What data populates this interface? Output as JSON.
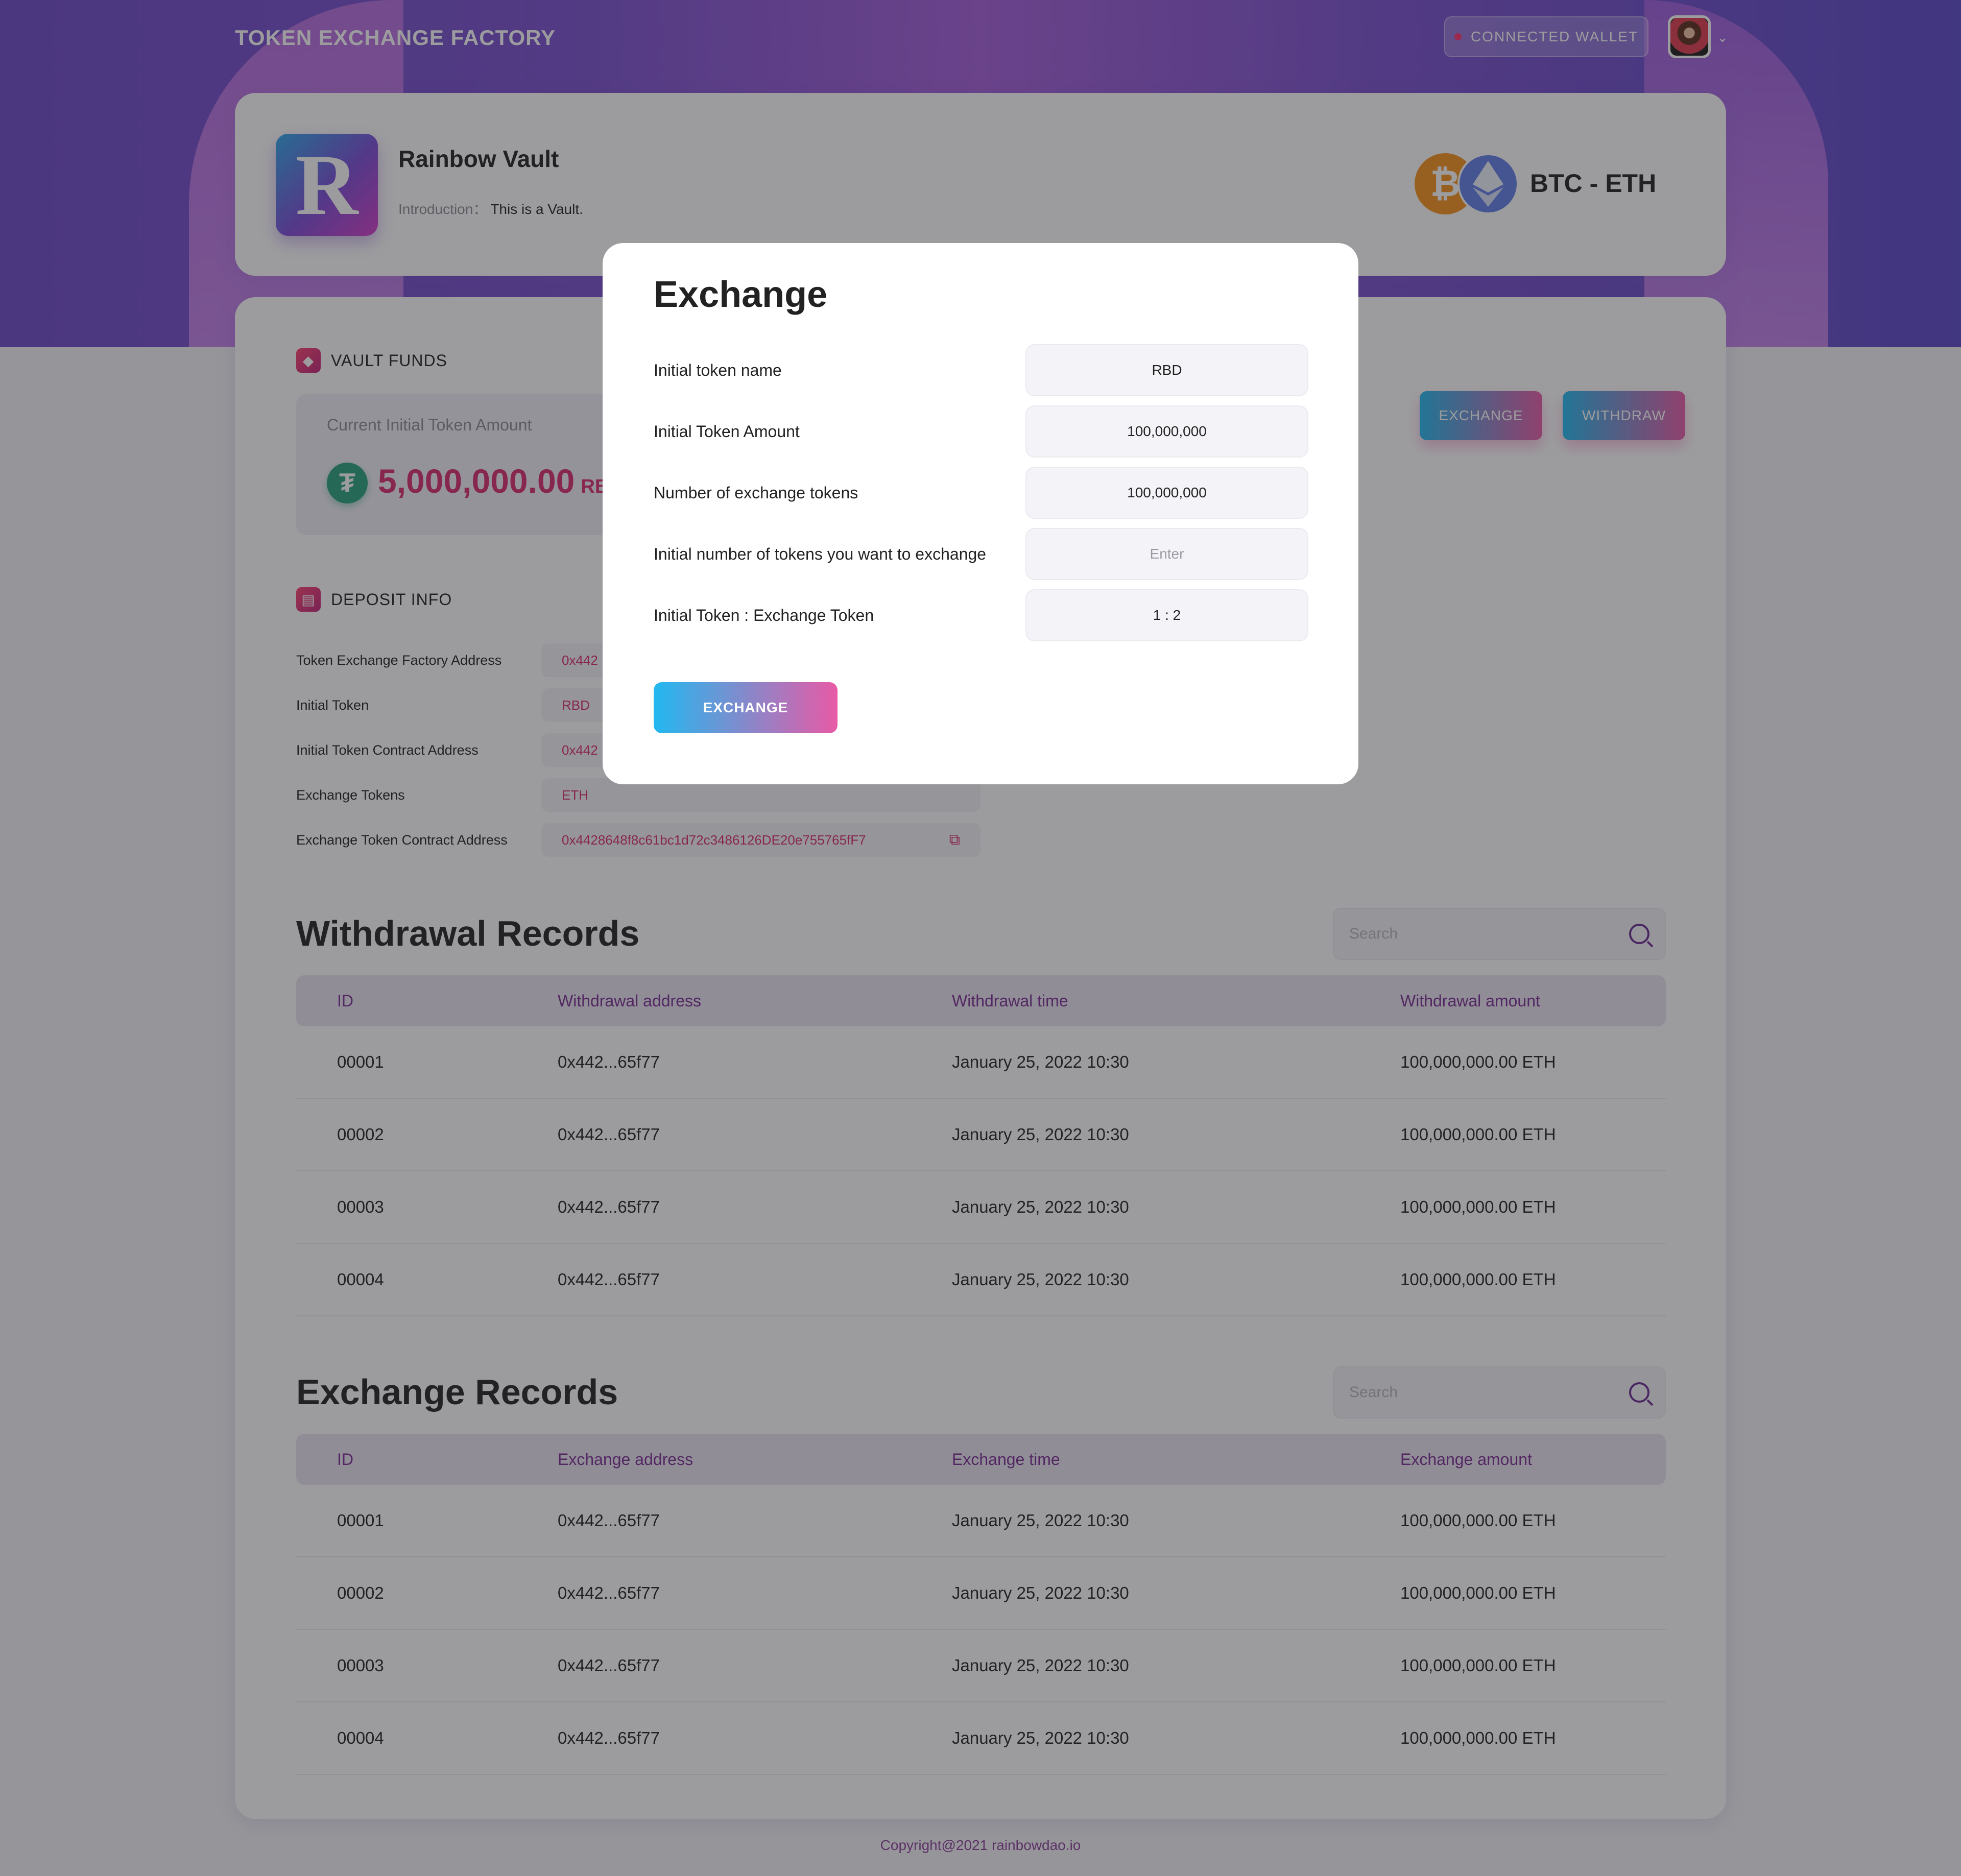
{
  "header": {
    "brand": "TOKEN EXCHANGE FACTORY",
    "wallet_label": "CONNECTED  WALLET",
    "chevron": "⌄"
  },
  "vault": {
    "logo_letter": "R",
    "name": "Rainbow Vault",
    "intro_label": "Introduction：",
    "intro_value": "This is a Vault.",
    "pair": "BTC - ETH",
    "btc_symbol": "₿",
    "eth_symbol": "◆"
  },
  "funds": {
    "section_title": "VAULT FUNDS",
    "label": "Current Initial Token Amount",
    "value": "5,000,000.00",
    "unit": "RBD",
    "tether_symbol": "₮",
    "exchange_btn": "EXCHANGE",
    "withdraw_btn": "WITHDRAW"
  },
  "deposit": {
    "section_title": "DEPOSIT INFO",
    "rows": [
      {
        "label": "Token Exchange Factory Address",
        "value": "0x442"
      },
      {
        "label": "Initial Token",
        "value": "RBD"
      },
      {
        "label": "Initial Token Contract Address",
        "value": "0x442"
      },
      {
        "label": "Exchange Tokens",
        "value": "ETH"
      },
      {
        "label": "Exchange Token Contract Address",
        "value": "0x4428648f8c61bc1d72c3486126DE20e755765fF7"
      }
    ]
  },
  "withdrawals": {
    "title": "Withdrawal Records",
    "search_placeholder": "Search",
    "columns": [
      "ID",
      "Withdrawal address",
      "Withdrawal time",
      "Withdrawal amount"
    ],
    "rows": [
      [
        "00001",
        "0x442...65f77",
        "January 25, 2022 10:30",
        "100,000,000.00 ETH"
      ],
      [
        "00002",
        "0x442...65f77",
        "January 25, 2022 10:30",
        "100,000,000.00 ETH"
      ],
      [
        "00003",
        "0x442...65f77",
        "January 25, 2022 10:30",
        "100,000,000.00 ETH"
      ],
      [
        "00004",
        "0x442...65f77",
        "January 25, 2022 10:30",
        "100,000,000.00 ETH"
      ]
    ]
  },
  "exchanges": {
    "title": "Exchange Records",
    "search_placeholder": "Search",
    "columns": [
      "ID",
      "Exchange address",
      "Exchange time",
      "Exchange amount"
    ],
    "rows": [
      [
        "00001",
        "0x442...65f77",
        "January 25, 2022 10:30",
        "100,000,000.00 ETH"
      ],
      [
        "00002",
        "0x442...65f77",
        "January 25, 2022 10:30",
        "100,000,000.00 ETH"
      ],
      [
        "00003",
        "0x442...65f77",
        "January 25, 2022 10:30",
        "100,000,000.00 ETH"
      ],
      [
        "00004",
        "0x442...65f77",
        "January 25, 2022 10:30",
        "100,000,000.00 ETH"
      ]
    ]
  },
  "footer": {
    "copyright": "Copyright@2021 rainbowdao.io"
  },
  "modal": {
    "title": "Exchange",
    "fields": [
      {
        "label": "Initial token name",
        "value": "RBD"
      },
      {
        "label": "Initial Token Amount",
        "value": "100,000,000"
      },
      {
        "label": "Number of exchange tokens",
        "value": "100,000,000"
      },
      {
        "label": "Initial number of tokens you want to exchange",
        "value": "",
        "placeholder": "Enter"
      },
      {
        "label": "Initial Token : Exchange Token",
        "value": "1  :  2"
      }
    ],
    "button": "EXCHANGE"
  },
  "icons": {
    "gem": "gem-icon",
    "doc": "document-icon",
    "copy": "copy-icon",
    "search": "search-icon"
  },
  "colors": {
    "accent_pink": "#d92b6f",
    "accent_purple": "#7a2a92",
    "gradient_start": "#22b8f0",
    "gradient_end": "#e85aa6"
  }
}
